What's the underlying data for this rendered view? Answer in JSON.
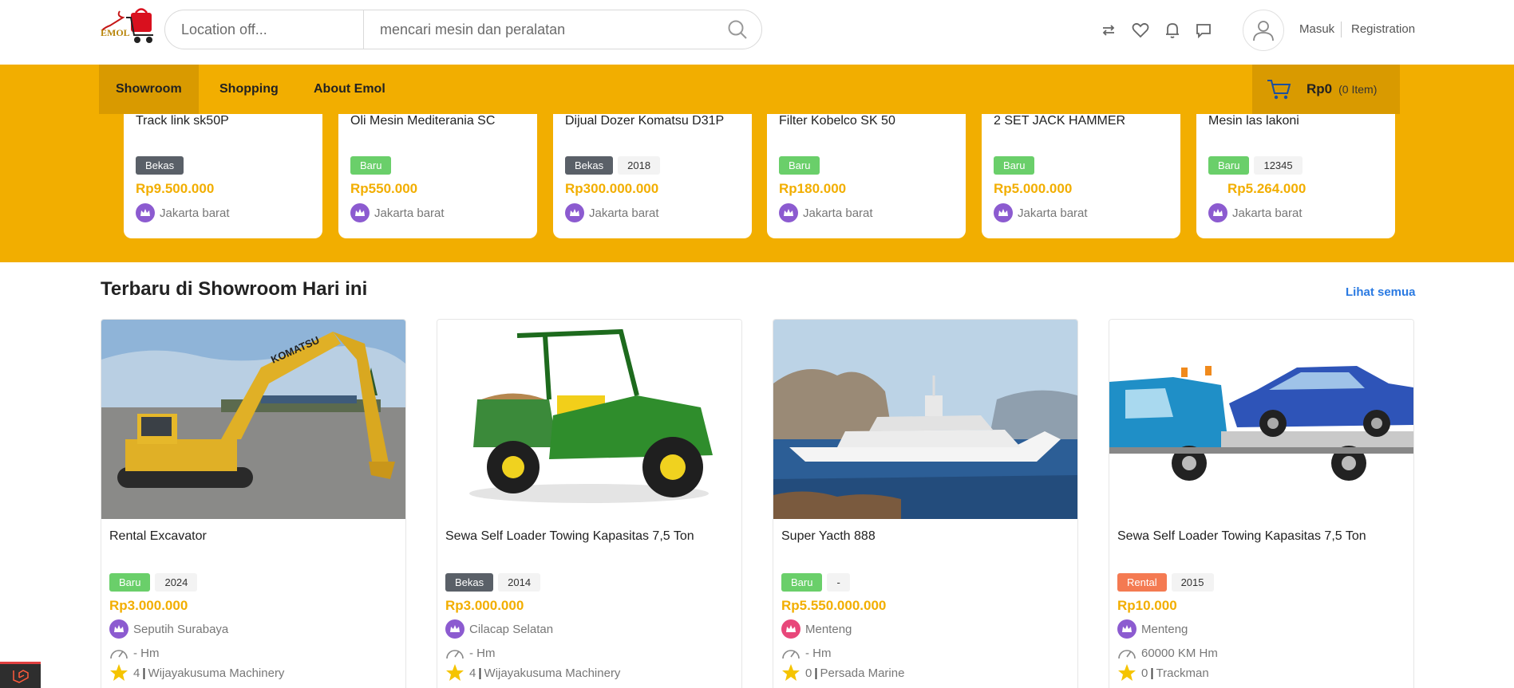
{
  "header": {
    "logo_text": "EMOL",
    "location_placeholder": "Location off...",
    "search_placeholder": "mencari mesin dan peralatan",
    "login_label": "Masuk",
    "register_label": "Registration"
  },
  "nav": {
    "items": [
      "Showroom",
      "Shopping",
      "About Emol"
    ],
    "active": "Showroom"
  },
  "cart": {
    "price": "Rp0",
    "count": "(0 Item)"
  },
  "featured": [
    {
      "title": "Track link sk50P",
      "condition": "Bekas",
      "year": "",
      "price": "Rp9.500.000",
      "location": "Jakarta barat"
    },
    {
      "title": "Oli Mesin Mediterania SC",
      "condition": "Baru",
      "year": "",
      "price": "Rp550.000",
      "location": "Jakarta barat"
    },
    {
      "title": "Dijual Dozer Komatsu D31P",
      "condition": "Bekas",
      "year": "2018",
      "price": "Rp300.000.000",
      "location": "Jakarta barat"
    },
    {
      "title": "Filter Kobelco SK 50",
      "condition": "Baru",
      "year": "",
      "price": "Rp180.000",
      "location": "Jakarta barat"
    },
    {
      "title": "2 SET JACK HAMMER",
      "condition": "Baru",
      "year": "",
      "price": "Rp5.000.000",
      "location": "Jakarta barat"
    },
    {
      "title": "Mesin las lakoni",
      "condition": "Baru",
      "year": "12345",
      "price": "Rp5.264.000",
      "location": "Jakarta barat"
    }
  ],
  "section": {
    "title": "Terbaru di Showroom Hari ini",
    "see_all": "Lihat semua"
  },
  "products": [
    {
      "title": "Rental Excavator",
      "condition": "Baru",
      "year": "2024",
      "price": "Rp3.000.000",
      "location": "Seputih Surabaya",
      "hours": "- Hm",
      "rating": "4",
      "seller": "Wijayakusuma Machinery"
    },
    {
      "title": "Sewa Self Loader Towing Kapasitas 7,5 Ton",
      "condition": "Bekas",
      "year": "2014",
      "price": "Rp3.000.000",
      "location": "Cilacap Selatan",
      "hours": "- Hm",
      "rating": "4",
      "seller": "Wijayakusuma Machinery"
    },
    {
      "title": "Super Yacth 888",
      "condition": "Baru",
      "year": "-",
      "price": "Rp5.550.000.000",
      "location": "Menteng",
      "hours": "- Hm",
      "rating": "0",
      "seller": "Persada Marine"
    },
    {
      "title": "Sewa Self Loader Towing Kapasitas 7,5 Ton",
      "condition": "Rental",
      "year": "2015",
      "price": "Rp10.000",
      "location": "Menteng",
      "hours": "60000 KM Hm",
      "rating": "0",
      "seller": "Trackman"
    }
  ],
  "colors": {
    "brand_yellow": "#f2ae00",
    "nav_active": "#d99a00",
    "link_blue": "#2a7ae2",
    "badge_baru": "#6acf6a",
    "badge_bekas": "#5a6068",
    "badge_rental": "#f47a52",
    "crown_purple": "#8c5bd0"
  },
  "icons": [
    "compare-icon",
    "heart-icon",
    "bell-icon",
    "chat-icon",
    "user-icon",
    "search-icon",
    "cart-icon",
    "crown-icon",
    "gauge-icon",
    "star-icon",
    "laravel-icon"
  ]
}
